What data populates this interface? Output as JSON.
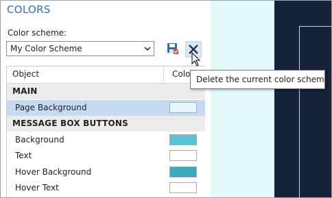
{
  "panel": {
    "title": "COLORS"
  },
  "scheme": {
    "label": "Color scheme:",
    "selected": "My Color Scheme"
  },
  "table": {
    "columns": [
      "Object",
      "Color"
    ],
    "rows": [
      {
        "type": "group",
        "label": "MAIN"
      },
      {
        "type": "item",
        "label": "Page Background",
        "color": "#e4f8fa",
        "selected": true
      },
      {
        "type": "group",
        "label": "MESSAGE BOX BUTTONS"
      },
      {
        "type": "item",
        "label": "Background",
        "color": "#5bc3d6"
      },
      {
        "type": "item",
        "label": "Text",
        "color": "#ffffff"
      },
      {
        "type": "item",
        "label": "Hover Background",
        "color": "#3aa8bd"
      },
      {
        "type": "item",
        "label": "Hover Text",
        "color": "#ffffff"
      }
    ]
  },
  "tooltip": {
    "text": "Delete the current color scheme"
  },
  "preview": {
    "background": "#e3f8f9",
    "dark": "#15223a"
  }
}
